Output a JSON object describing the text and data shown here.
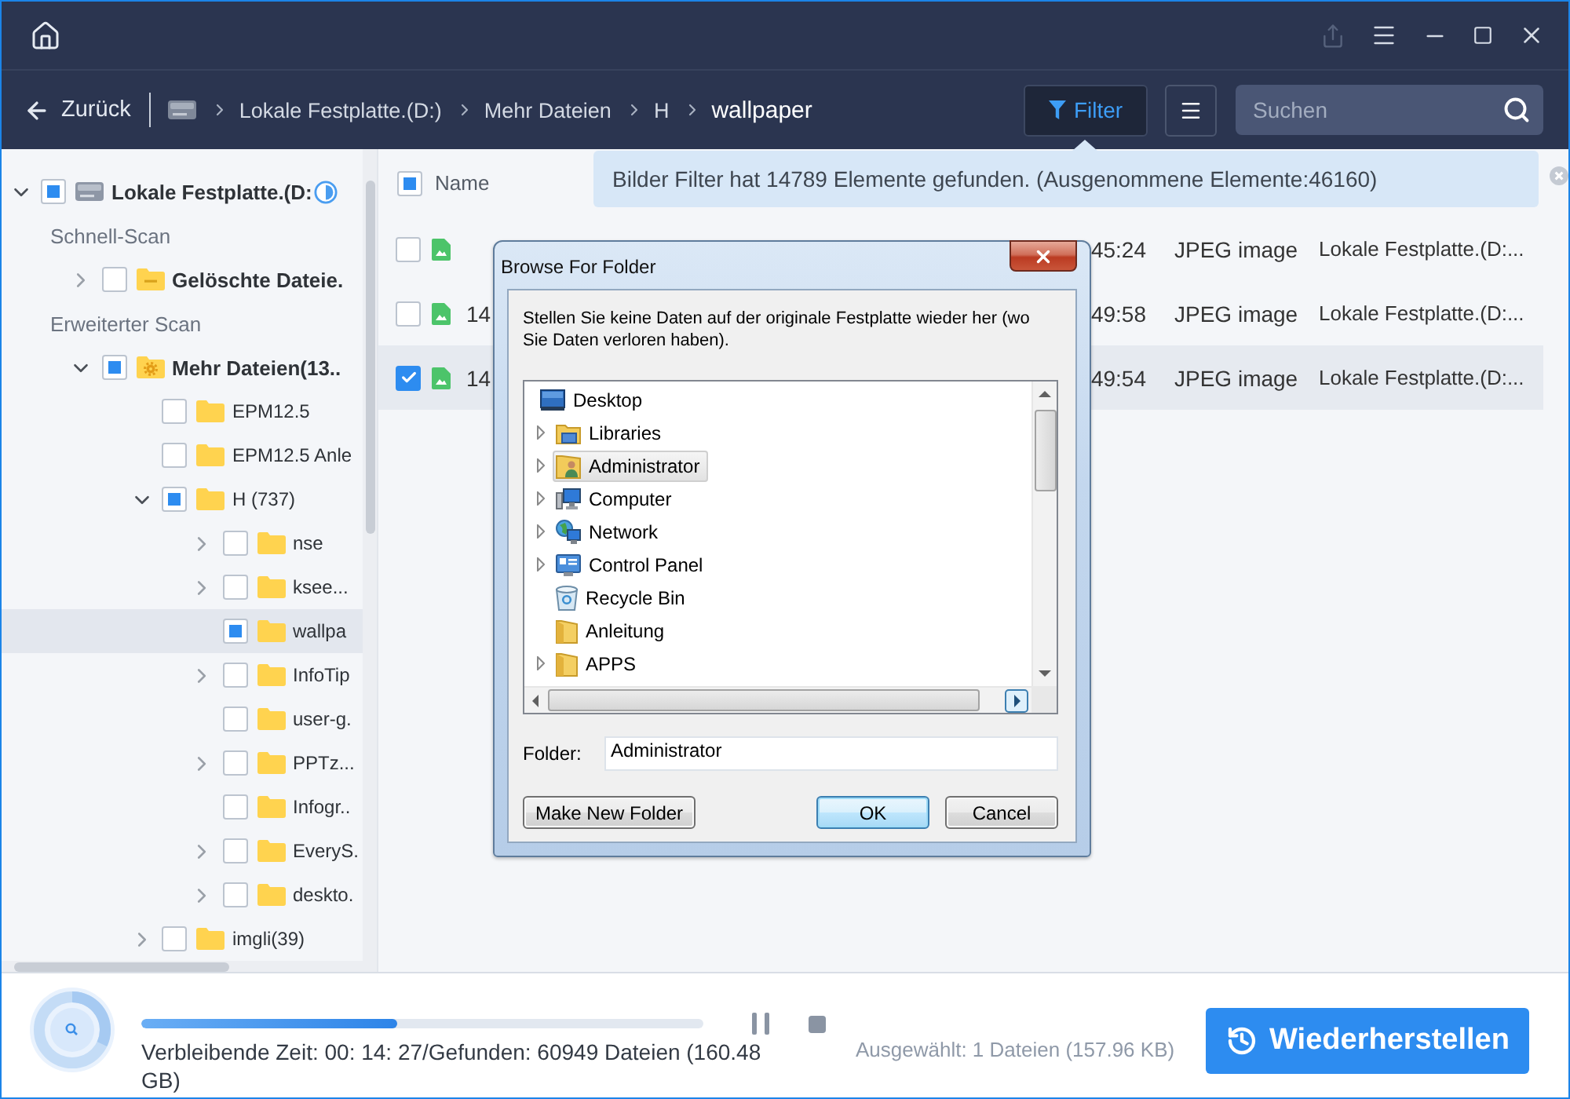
{
  "nav": {
    "back": "Zurück",
    "breadcrumbs": [
      {
        "label": "Lokale Festplatte.(D:)",
        "current": false
      },
      {
        "label": "Mehr Dateien",
        "current": false
      },
      {
        "label": "H",
        "current": false
      },
      {
        "label": "wallpaper",
        "current": true
      }
    ],
    "filter": {
      "label": "Filter",
      "active": true
    },
    "search": {
      "placeholder": "Suchen"
    }
  },
  "banner": {
    "text": "Bilder Filter hat 14789 Elemente gefunden. (Ausgenommene Elemente:46160)"
  },
  "tree": {
    "root": {
      "label": "Lokale Festplatte.(D:",
      "kind": "drive",
      "expandable": true,
      "expanded": true,
      "checked": false,
      "partial": true,
      "selected": false,
      "loading": true
    },
    "sections": [
      {
        "title": "Schnell-Scan",
        "items": [
          {
            "label": "Gelöschte Dateie.",
            "kind": "deleted",
            "expandable": true,
            "expanded": false,
            "checked": false,
            "partial": false,
            "selected": false
          }
        ]
      },
      {
        "title": "Erweiterter Scan",
        "items": [
          {
            "label": "Mehr Dateien(13..",
            "kind": "more",
            "expandable": true,
            "expanded": true,
            "checked": false,
            "partial": true,
            "selected": false,
            "children": [
              {
                "label": "EPM12.5",
                "kind": "folder",
                "expandable": false,
                "checked": false,
                "partial": false,
                "selected": false
              },
              {
                "label": "EPM12.5 Anle",
                "kind": "folder",
                "expandable": false,
                "checked": false,
                "partial": false,
                "selected": false
              },
              {
                "label": "H (737)",
                "kind": "folder",
                "expandable": true,
                "expanded": true,
                "checked": false,
                "partial": true,
                "selected": false,
                "children": [
                  {
                    "label": "nse",
                    "kind": "folder",
                    "expandable": true,
                    "expanded": false,
                    "checked": false,
                    "partial": false,
                    "selected": false
                  },
                  {
                    "label": "ksee...",
                    "kind": "folder",
                    "expandable": true,
                    "expanded": false,
                    "checked": false,
                    "partial": false,
                    "selected": false
                  },
                  {
                    "label": "wallpa",
                    "kind": "folder",
                    "expandable": false,
                    "checked": false,
                    "partial": true,
                    "selected": true
                  },
                  {
                    "label": "InfoTip",
                    "kind": "folder",
                    "expandable": true,
                    "expanded": false,
                    "checked": false,
                    "partial": false,
                    "selected": false
                  },
                  {
                    "label": "user-g.",
                    "kind": "folder",
                    "expandable": false,
                    "checked": false,
                    "partial": false,
                    "selected": false
                  },
                  {
                    "label": "PPTz...",
                    "kind": "folder",
                    "expandable": true,
                    "expanded": false,
                    "checked": false,
                    "partial": false,
                    "selected": false
                  },
                  {
                    "label": "Infogr..",
                    "kind": "folder",
                    "expandable": false,
                    "checked": false,
                    "partial": false,
                    "selected": false
                  },
                  {
                    "label": "EveryS.",
                    "kind": "folder",
                    "expandable": true,
                    "expanded": false,
                    "checked": false,
                    "partial": false,
                    "selected": false
                  },
                  {
                    "label": "deskto.",
                    "kind": "folder",
                    "expandable": true,
                    "expanded": false,
                    "checked": false,
                    "partial": false,
                    "selected": false
                  }
                ]
              },
              {
                "label": "imgli(39)",
                "kind": "folder",
                "expandable": true,
                "expanded": false,
                "checked": false,
                "partial": false,
                "selected": false
              }
            ]
          }
        ]
      }
    ]
  },
  "table": {
    "header": {
      "label": "Name",
      "checked": false,
      "partial": true
    },
    "rows": [
      {
        "checked": false,
        "selected": false,
        "column_3": "45:24",
        "column_4": "JPEG image",
        "column_5": "Lokale Festplatte.(D:..."
      },
      {
        "checked": false,
        "selected": false,
        "name": "14",
        "column_3": "49:58",
        "column_4": "JPEG image",
        "column_5": "Lokale Festplatte.(D:..."
      },
      {
        "checked": true,
        "selected": true,
        "name": "14",
        "column_3": "49:54",
        "column_4": "JPEG image",
        "column_5": "Lokale Festplatte.(D:..."
      }
    ]
  },
  "dialog": {
    "title": "Browse For Folder",
    "description": "Stellen Sie keine Daten auf der originale Festplatte wieder her (wo Sie Daten verloren haben).",
    "folders": [
      {
        "label": "Desktop",
        "kind": "desktop",
        "expandable": false,
        "selected": false,
        "children": [
          {
            "label": "Libraries",
            "kind": "library",
            "expandable": true,
            "selected": false
          },
          {
            "label": "Administrator",
            "kind": "user",
            "expandable": true,
            "selected": true
          },
          {
            "label": "Computer",
            "kind": "computer",
            "expandable": true,
            "selected": false
          },
          {
            "label": "Network",
            "kind": "network",
            "expandable": true,
            "selected": false
          },
          {
            "label": "Control Panel",
            "kind": "control-panel",
            "expandable": true,
            "selected": false
          },
          {
            "label": "Recycle Bin",
            "kind": "recycle-bin",
            "expandable": false,
            "selected": false
          },
          {
            "label": "Anleitung",
            "kind": "folder",
            "expandable": false,
            "selected": false
          },
          {
            "label": "APPS",
            "kind": "folder",
            "expandable": true,
            "selected": false
          }
        ]
      }
    ],
    "folder_label": "Folder:",
    "folder_value": "Administrator",
    "buttons": [
      {
        "label": "Make New Folder",
        "default": false
      },
      {
        "label": "OK",
        "default": true
      },
      {
        "label": "Cancel",
        "default": false
      }
    ]
  },
  "footer": {
    "progress": {
      "level": 0.455
    },
    "status": "Verbleibende Zeit: 00: 14: 27/Gefunden: 60949 Dateien (160.48 GB)",
    "selected_info": "Ausgewählt: 1 Dateien (157.96 KB)",
    "recover": "Wiederherstellen"
  }
}
